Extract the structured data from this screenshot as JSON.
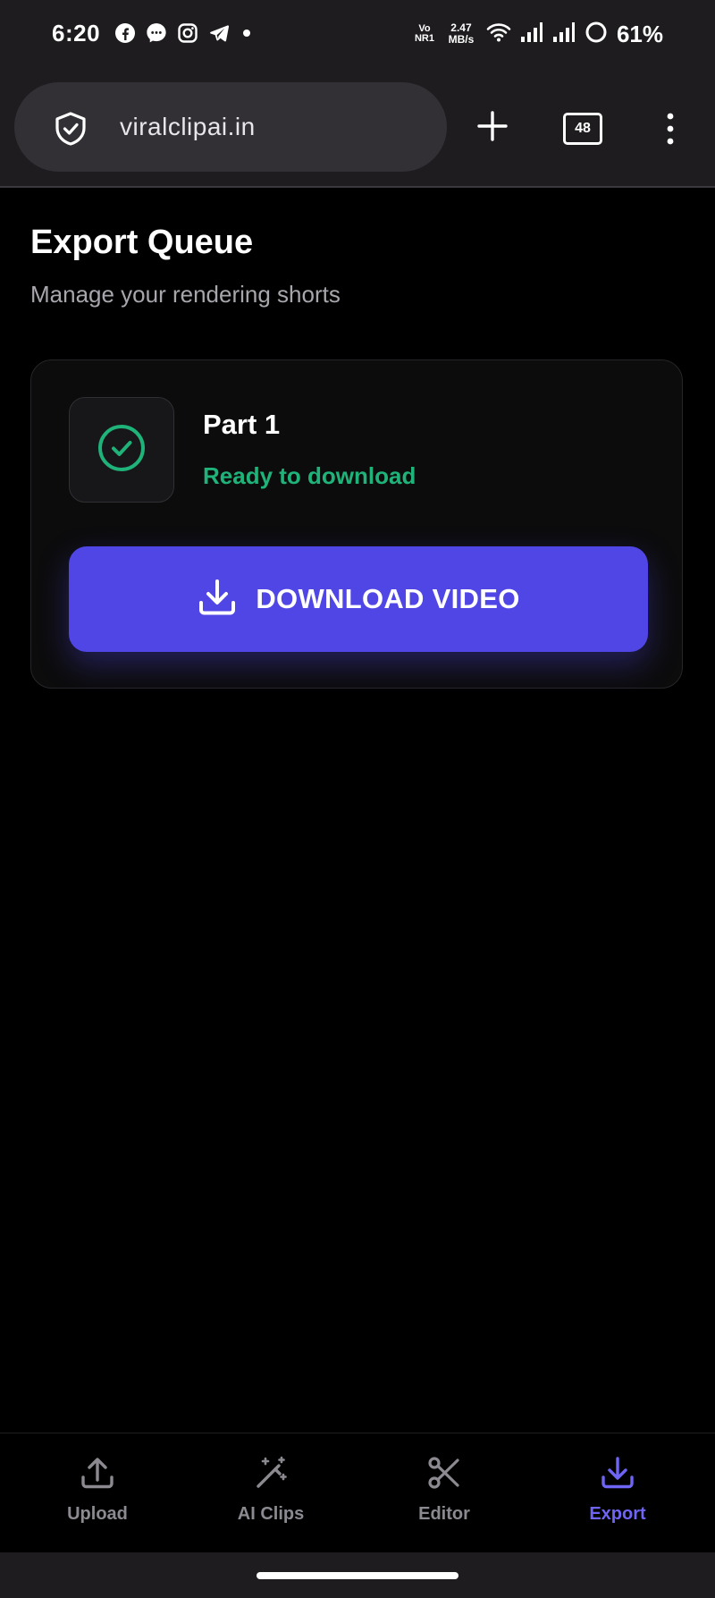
{
  "status_bar": {
    "time": "6:20",
    "volte_line1": "Vo",
    "volte_line2": "NR1",
    "net_speed_value": "2.47",
    "net_speed_unit": "MB/s",
    "battery_percent": "61%",
    "icons": [
      "facebook-icon",
      "messenger-icon",
      "instagram-icon",
      "telegram-icon",
      "dot-icon",
      "wifi-icon",
      "signal-icon",
      "signal-icon",
      "battery-ring-icon"
    ]
  },
  "browser": {
    "url": "viralclipai.in",
    "tab_count": "48"
  },
  "page": {
    "title": "Export Queue",
    "subtitle": "Manage your rendering shorts"
  },
  "queue": {
    "items": [
      {
        "title": "Part 1",
        "status": "Ready to download",
        "download_label": "DOWNLOAD VIDEO"
      }
    ]
  },
  "nav": {
    "items": [
      {
        "label": "Upload",
        "icon": "upload-icon",
        "active": false
      },
      {
        "label": "AI Clips",
        "icon": "magic-wand-icon",
        "active": false
      },
      {
        "label": "Editor",
        "icon": "scissors-icon",
        "active": false
      },
      {
        "label": "Export",
        "icon": "download-icon",
        "active": true
      }
    ]
  },
  "colors": {
    "accent": "#5046e5",
    "accent_text": "#6f65f5",
    "success": "#1fb37a",
    "background": "#000000",
    "chrome": "#1e1c1f"
  }
}
